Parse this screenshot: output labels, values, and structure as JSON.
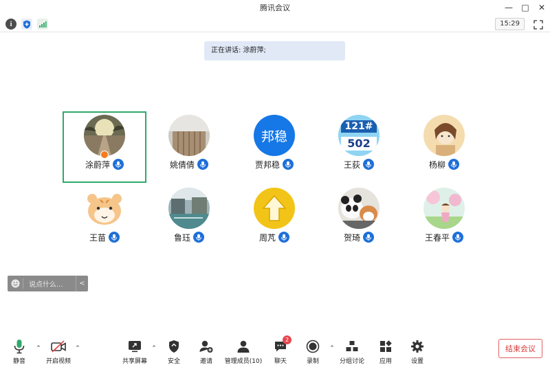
{
  "window": {
    "title": "腾讯会议",
    "controls": [
      "—",
      "□",
      "✕"
    ]
  },
  "infobar": {
    "time": "15:29"
  },
  "speaking": {
    "text": "正在讲话: 涂蔚萍;"
  },
  "participants": [
    {
      "name": "涂蔚萍",
      "avatar": "photo-road",
      "active": true,
      "host": true
    },
    {
      "name": "姚倩倩",
      "avatar": "photo-room"
    },
    {
      "name": "贾邦稳",
      "avatar": "text-avatar",
      "avatar_text": "邦稳",
      "avatar_color": "#1677e6"
    },
    {
      "name": "王荻",
      "avatar": "number-sign",
      "avatar_text_top": "121#",
      "avatar_text_bottom": "502"
    },
    {
      "name": "杨柳",
      "avatar": "illustration-girl"
    },
    {
      "name": "王苗",
      "avatar": "cartoon-tiger"
    },
    {
      "name": "鲁珏",
      "avatar": "photo-town"
    },
    {
      "name": "周芃",
      "avatar": "up-arrow-sign"
    },
    {
      "name": "贺琦",
      "avatar": "photo-panda-cat"
    },
    {
      "name": "王春平",
      "avatar": "illustration-spring"
    }
  ],
  "chat": {
    "placeholder": "说点什么...",
    "collapse": "<"
  },
  "toolbar": {
    "mute": "静音",
    "video": "开启视频",
    "share": "共享屏幕",
    "security": "安全",
    "invite": "邀请",
    "members": "管理成员(10)",
    "chat": "聊天",
    "chat_badge": "2",
    "record": "录制",
    "breakout": "分组讨论",
    "apps": "应用",
    "settings": "设置",
    "end": "结束会议"
  },
  "colors": {
    "accent_blue": "#1e6fd9",
    "active_green": "#2ea96b",
    "end_red": "#d83a3a",
    "speaking_bg": "#e1e9f7"
  }
}
